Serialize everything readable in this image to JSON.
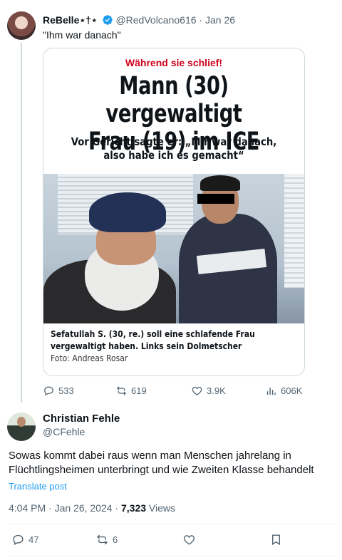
{
  "quoted_tweet": {
    "display_name": "ReBelle⋆†⋆",
    "handle": "@RedVolcano616",
    "date": "Jan 26",
    "text": "\"Ihm war danach\"",
    "media": {
      "kicker": "Während sie schlief!",
      "headline_line1": "Mann (30) vergewaltigt",
      "headline_line2": "Frau (19) im ICE",
      "subheadline": "Vor Gericht sagte er: „Mir war danach, also habe ich es gemacht“",
      "caption": "Sefatullah S. (30, re.) soll eine schlafende Frau vergewaltigt haben. Links sein Dolmetscher",
      "credit": "Foto: Andreas Rosar"
    },
    "actions": {
      "replies": "533",
      "reposts": "619",
      "likes": "3.9K",
      "views": "606K"
    }
  },
  "main_tweet": {
    "display_name": "Christian Fehle",
    "handle": "@CFehle",
    "text": "Sowas kommt dabei raus wenn man Menschen jahrelang in Flüchtlingsheimen unterbringt und wie Zweiten Klasse behandelt",
    "translate_label": "Translate post",
    "timestamp": "4:04 PM · Jan 26, 2024 · ",
    "views_count": "7,323",
    "views_label": " Views",
    "actions": {
      "replies": "47",
      "reposts": "6"
    }
  },
  "colors": {
    "accent": "#1d9bf0",
    "secondary_text": "#536471",
    "kicker_red": "#d0021b"
  }
}
